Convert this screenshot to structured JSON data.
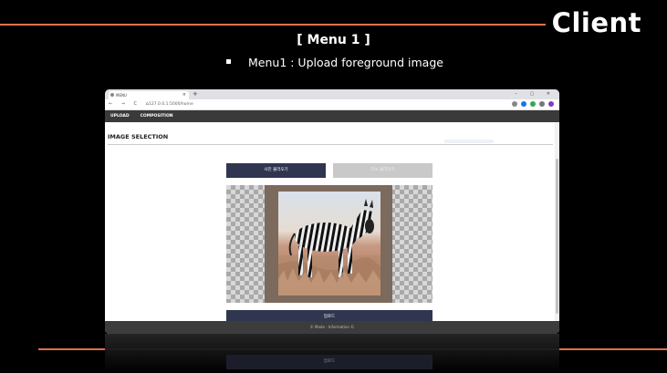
{
  "slide": {
    "corner_title": "Client",
    "menu_title": "[ Menu 1 ]",
    "bullet": "Menu1 : Upload foreground image",
    "accent_color": "#e2704a"
  },
  "browser": {
    "tab_title": "MENU",
    "new_tab": "+",
    "window_controls": "– ▢ ✕",
    "nav_icons": "← → C ⌂",
    "url": "127.0.0.1:5000/home"
  },
  "app": {
    "nav": [
      "UPLOAD",
      "COMPOSITION"
    ],
    "page_heading": "IMAGE SELECTION",
    "load_photo_button": "사진 불러오기",
    "reset_button": "다시 불러오기",
    "upload_button": "업로드",
    "footer": "© Made : Information ©"
  },
  "reflection": {
    "upload_button": "업로드"
  }
}
